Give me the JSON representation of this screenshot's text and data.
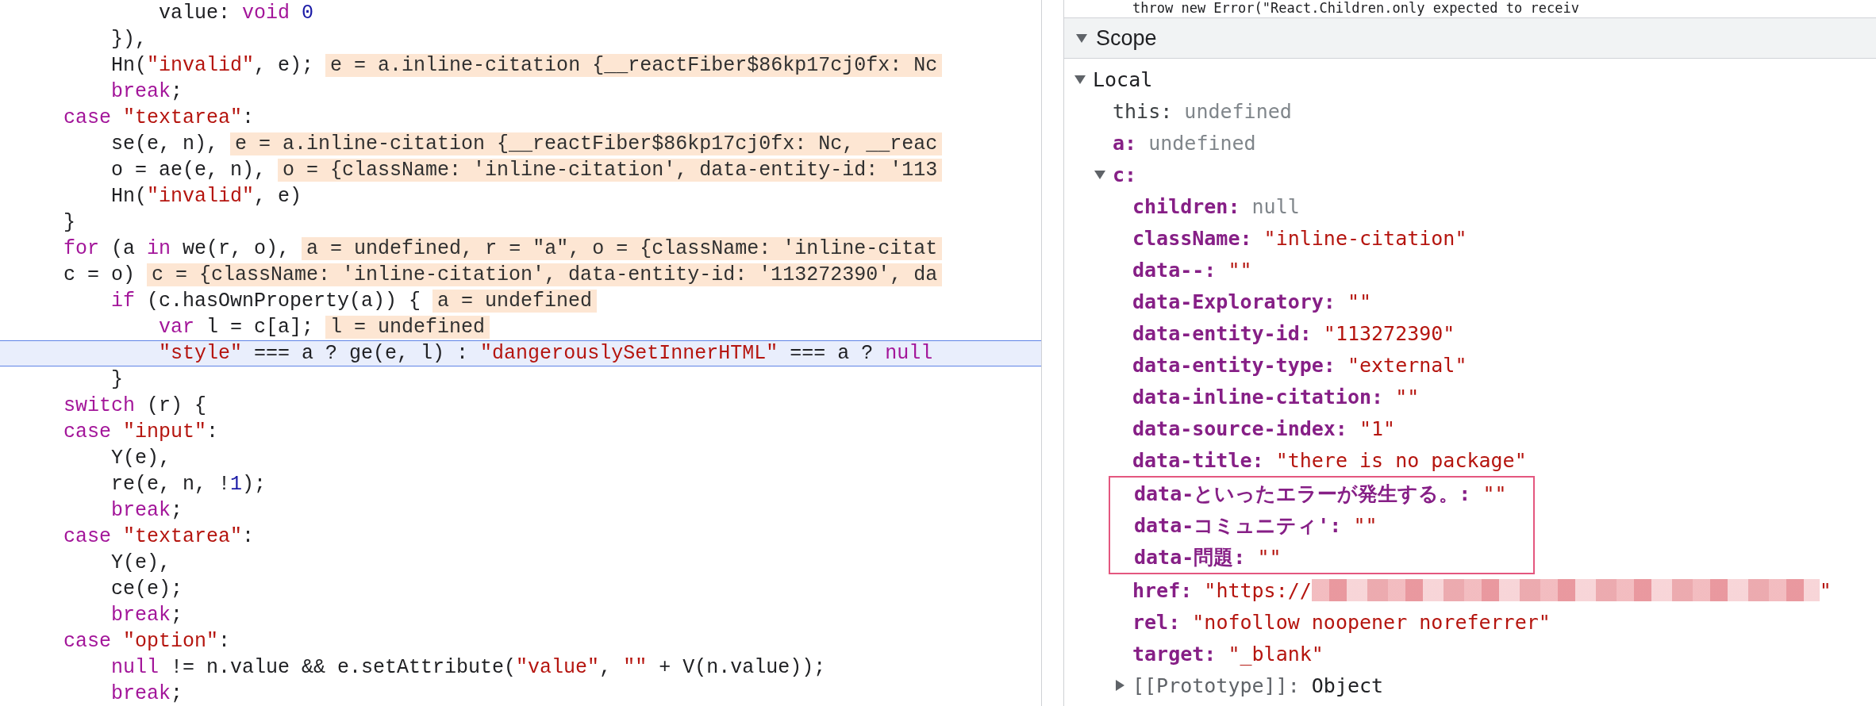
{
  "code": {
    "lines": [
      {
        "current": false,
        "tokens": [
          {
            "kind": "plain",
            "text": "            value: "
          },
          {
            "kind": "keyword",
            "text": "void"
          },
          {
            "kind": "number",
            "text": " 0"
          }
        ]
      },
      {
        "current": false,
        "tokens": [
          {
            "kind": "plain",
            "text": "        }),"
          }
        ]
      },
      {
        "current": false,
        "tokens": [
          {
            "kind": "plain",
            "text": "        Hn("
          },
          {
            "kind": "string",
            "text": "\"invalid\""
          },
          {
            "kind": "plain",
            "text": ", e);"
          }
        ],
        "inline_value": "e = a.inline-citation {__reactFiber$86kp17cj0fx: Nc"
      },
      {
        "current": false,
        "tokens": [
          {
            "kind": "keyword",
            "text": "        break"
          },
          {
            "kind": "plain",
            "text": ";"
          }
        ]
      },
      {
        "current": false,
        "tokens": [
          {
            "kind": "keyword",
            "text": "    case"
          },
          {
            "kind": "string",
            "text": " \"textarea\""
          },
          {
            "kind": "plain",
            "text": ":"
          }
        ]
      },
      {
        "current": false,
        "tokens": [
          {
            "kind": "plain",
            "text": "        se(e, n),"
          }
        ],
        "inline_value": "e = a.inline-citation {__reactFiber$86kp17cj0fx: Nc, __reac"
      },
      {
        "current": false,
        "tokens": [
          {
            "kind": "plain",
            "text": "        o = ae(e, n),"
          }
        ],
        "inline_value": "o = {className: 'inline-citation', data-entity-id: '113"
      },
      {
        "current": false,
        "tokens": [
          {
            "kind": "plain",
            "text": "        Hn("
          },
          {
            "kind": "string",
            "text": "\"invalid\""
          },
          {
            "kind": "plain",
            "text": ", e)"
          }
        ]
      },
      {
        "current": false,
        "tokens": [
          {
            "kind": "plain",
            "text": "    }"
          }
        ]
      },
      {
        "current": false,
        "tokens": [
          {
            "kind": "keyword",
            "text": "    for"
          },
          {
            "kind": "plain",
            "text": " (a "
          },
          {
            "kind": "keyword",
            "text": "in"
          },
          {
            "kind": "plain",
            "text": " we(r, o),"
          }
        ],
        "inline_value": "a = undefined, r = \"a\", o = {className: 'inline-citat"
      },
      {
        "current": false,
        "tokens": [
          {
            "kind": "plain",
            "text": "    c = o)"
          }
        ],
        "inline_value": "c = {className: 'inline-citation', data-entity-id: '113272390', da"
      },
      {
        "current": false,
        "tokens": [
          {
            "kind": "keyword",
            "text": "        if"
          },
          {
            "kind": "plain",
            "text": " (c.hasOwnProperty(a)) {"
          }
        ],
        "inline_value": "a = undefined"
      },
      {
        "current": false,
        "tokens": [
          {
            "kind": "keyword",
            "text": "            var"
          },
          {
            "kind": "plain",
            "text": " l = c[a];"
          }
        ],
        "inline_value": "l = undefined"
      },
      {
        "current": true,
        "tokens": [
          {
            "kind": "string",
            "text": "            \"style\""
          },
          {
            "kind": "plain",
            "text": " === a ? ge(e, l) : "
          },
          {
            "kind": "string",
            "text": "\"dangerouslySetInnerHTML\""
          },
          {
            "kind": "plain",
            "text": " === a ? "
          },
          {
            "kind": "keyword",
            "text": "null"
          }
        ]
      },
      {
        "current": false,
        "tokens": [
          {
            "kind": "plain",
            "text": "        }"
          }
        ]
      },
      {
        "current": false,
        "tokens": [
          {
            "kind": "keyword",
            "text": "    switch"
          },
          {
            "kind": "plain",
            "text": " (r) {"
          }
        ]
      },
      {
        "current": false,
        "tokens": [
          {
            "kind": "keyword",
            "text": "    case"
          },
          {
            "kind": "string",
            "text": " \"input\""
          },
          {
            "kind": "plain",
            "text": ":"
          }
        ]
      },
      {
        "current": false,
        "tokens": [
          {
            "kind": "plain",
            "text": "        Y(e),"
          }
        ]
      },
      {
        "current": false,
        "tokens": [
          {
            "kind": "plain",
            "text": "        re(e, n, !"
          },
          {
            "kind": "number",
            "text": "1"
          },
          {
            "kind": "plain",
            "text": ");"
          }
        ]
      },
      {
        "current": false,
        "tokens": [
          {
            "kind": "keyword",
            "text": "        break"
          },
          {
            "kind": "plain",
            "text": ";"
          }
        ]
      },
      {
        "current": false,
        "tokens": [
          {
            "kind": "keyword",
            "text": "    case"
          },
          {
            "kind": "string",
            "text": " \"textarea\""
          },
          {
            "kind": "plain",
            "text": ":"
          }
        ]
      },
      {
        "current": false,
        "tokens": [
          {
            "kind": "plain",
            "text": "        Y(e),"
          }
        ]
      },
      {
        "current": false,
        "tokens": [
          {
            "kind": "plain",
            "text": "        ce(e);"
          }
        ]
      },
      {
        "current": false,
        "tokens": [
          {
            "kind": "keyword",
            "text": "        break"
          },
          {
            "kind": "plain",
            "text": ";"
          }
        ]
      },
      {
        "current": false,
        "tokens": [
          {
            "kind": "keyword",
            "text": "    case"
          },
          {
            "kind": "string",
            "text": " \"option\""
          },
          {
            "kind": "plain",
            "text": ":"
          }
        ]
      },
      {
        "current": false,
        "tokens": [
          {
            "kind": "keyword",
            "text": "        null"
          },
          {
            "kind": "plain",
            "text": " != n.value && e.setAttribute("
          },
          {
            "kind": "string",
            "text": "\"value\""
          },
          {
            "kind": "plain",
            "text": ", "
          },
          {
            "kind": "string",
            "text": "\"\""
          },
          {
            "kind": "plain",
            "text": " + V(n.value));"
          }
        ]
      },
      {
        "current": false,
        "tokens": [
          {
            "kind": "keyword",
            "text": "        break"
          },
          {
            "kind": "plain",
            "text": ";"
          }
        ]
      }
    ]
  },
  "source_partial_line": "throw new Error(\"React.Children.only expected to receiv",
  "scope": {
    "title": "Scope",
    "expanded": true,
    "groups": [
      {
        "name": "Local",
        "expanded": true,
        "children": [
          {
            "name": "this:",
            "kind": "special",
            "value": {
              "kind": "dim",
              "text": "undefined"
            }
          },
          {
            "name": "a:",
            "kind": "own",
            "value": {
              "kind": "dim",
              "text": "undefined"
            }
          },
          {
            "name": "c:",
            "kind": "own",
            "expanded": true,
            "children": [
              {
                "name": "children:",
                "kind": "own",
                "value": {
                  "kind": "dim",
                  "text": "null"
                },
                "outlined": false
              },
              {
                "name": "className:",
                "kind": "own",
                "value": {
                  "kind": "string",
                  "text": "\"inline-citation\""
                },
                "outlined": false
              },
              {
                "name": "data--:",
                "kind": "own",
                "value": {
                  "kind": "string",
                  "text": "\"\""
                },
                "outlined": false
              },
              {
                "name": "data-Exploratory:",
                "kind": "own",
                "value": {
                  "kind": "string",
                  "text": "\"\""
                },
                "outlined": false
              },
              {
                "name": "data-entity-id:",
                "kind": "own",
                "value": {
                  "kind": "string",
                  "text": "\"113272390\""
                },
                "outlined": false
              },
              {
                "name": "data-entity-type:",
                "kind": "own",
                "value": {
                  "kind": "string",
                  "text": "\"external\""
                },
                "outlined": false
              },
              {
                "name": "data-inline-citation:",
                "kind": "own",
                "value": {
                  "kind": "string",
                  "text": "\"\""
                },
                "outlined": false
              },
              {
                "name": "data-source-index:",
                "kind": "own",
                "value": {
                  "kind": "string",
                  "text": "\"1\""
                },
                "outlined": false
              },
              {
                "name": "data-title:",
                "kind": "own",
                "value": {
                  "kind": "string",
                  "text": "\"there is no package\""
                },
                "outlined": false
              },
              {
                "name": "data-といったエラーが発生する。:",
                "kind": "own",
                "value": {
                  "kind": "string",
                  "text": "\"\""
                },
                "outlined": true
              },
              {
                "name": "data-コミュニティ':",
                "kind": "own",
                "value": {
                  "kind": "string",
                  "text": "\"\""
                },
                "outlined": true
              },
              {
                "name": "data-問題:",
                "kind": "own",
                "value": {
                  "kind": "string",
                  "text": "\"\""
                },
                "outlined": true
              },
              {
                "name": "href:",
                "kind": "own",
                "value": {
                  "kind": "string",
                  "text": "\"https://"
                },
                "value_end": "\"",
                "redacted": true,
                "outlined": false
              },
              {
                "name": "rel:",
                "kind": "own",
                "value": {
                  "kind": "string",
                  "text": "\"nofollow noopener noreferrer\""
                },
                "outlined": false
              },
              {
                "name": "target:",
                "kind": "own",
                "value": {
                  "kind": "string",
                  "text": "\"_blank\""
                },
                "outlined": false
              },
              {
                "name": "[[Prototype]]:",
                "kind": "internal",
                "expanded": false,
                "value": {
                  "kind": "object",
                  "text": "Object"
                },
                "outlined": false
              }
            ]
          }
        ]
      }
    ]
  }
}
